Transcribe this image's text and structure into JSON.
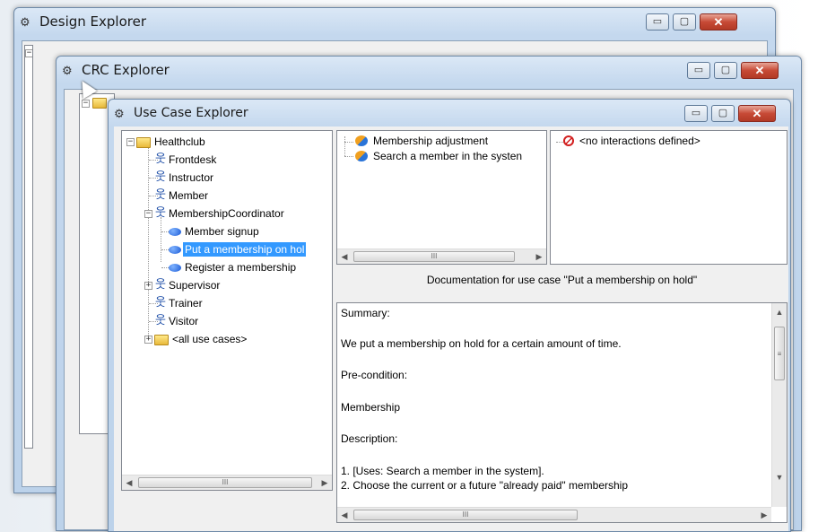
{
  "design_explorer": {
    "title": "Design Explorer"
  },
  "crc_explorer": {
    "title": "CRC Explorer"
  },
  "use_case_explorer": {
    "title": "Use Case Explorer",
    "tree": {
      "root": "Healthclub",
      "actors": [
        "Frontdesk",
        "Instructor",
        "Member",
        "MembershipCoordinator"
      ],
      "use_cases": [
        "Member signup",
        "Put a membership on hol",
        "Register a membership"
      ],
      "actors_after": [
        "Supervisor",
        "Trainer",
        "Visitor"
      ],
      "all_use_cases": "<all use cases>"
    },
    "related_use_cases": [
      "Membership adjustment",
      "Search a member in the systen"
    ],
    "interactions_placeholder": "<no interactions defined>",
    "doc_heading": "Documentation for use case \"Put a membership on hold\"",
    "doc_lines": [
      "Summary:",
      "We put a membership on hold for a certain amount of time.",
      "Pre-condition:",
      "Membership",
      "Description:",
      "1.   [Uses: Search a member in the system].",
      "2.   Choose the current or a future \"already paid\" membership"
    ]
  },
  "window_buttons": {
    "minimize": "▭",
    "maximize": "▢",
    "close": "✕"
  },
  "scroll_glyphs": {
    "left": "◀",
    "right": "▶",
    "up": "▲",
    "down": "▼",
    "grip": "III",
    "vgrip": "≡"
  },
  "colors": {
    "selection": "#3399ff",
    "close_button": "#c74a36",
    "title_bar": "#c4d8ee"
  }
}
